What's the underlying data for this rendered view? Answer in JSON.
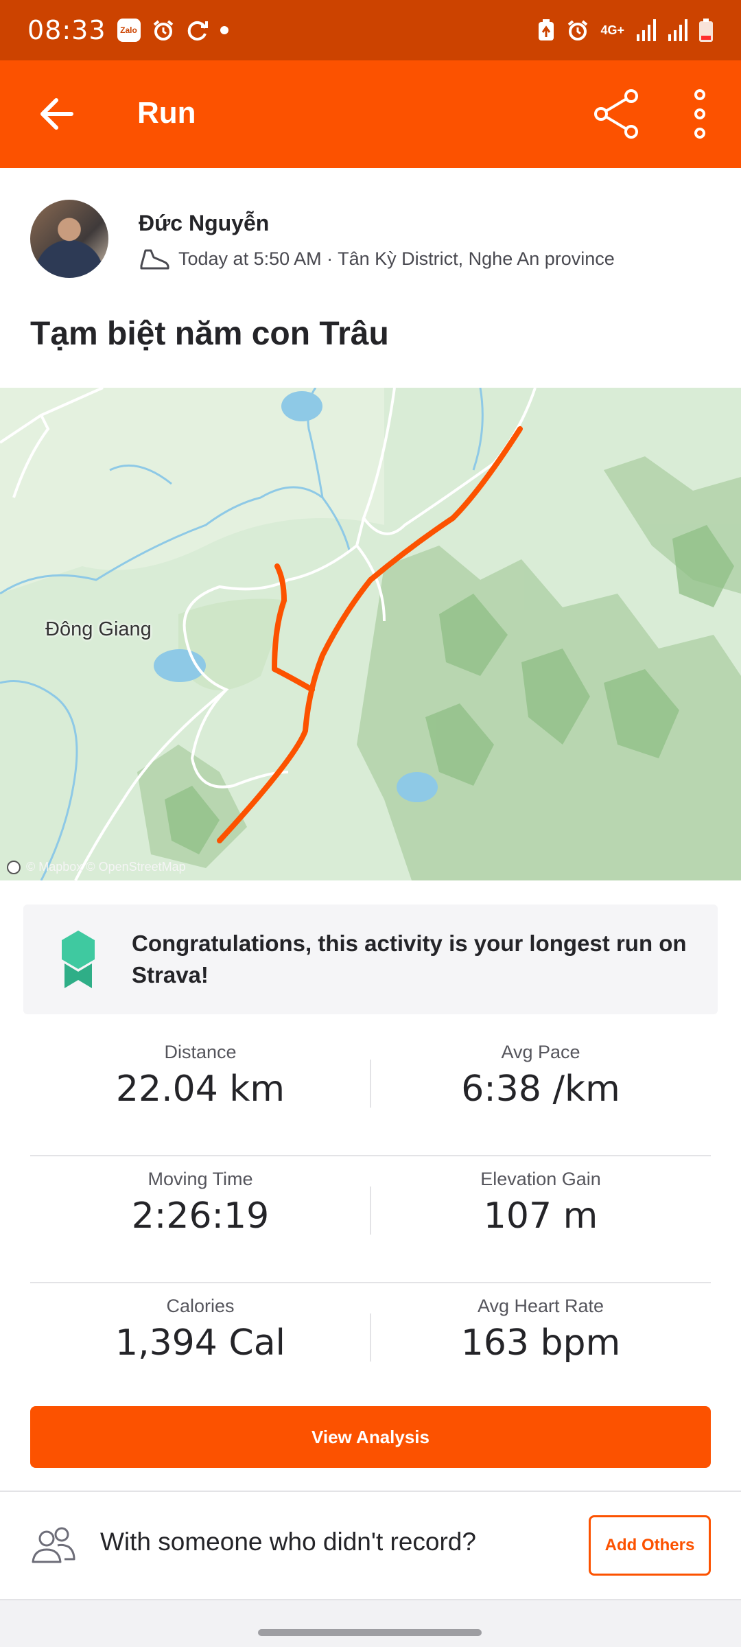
{
  "status_bar": {
    "time": "08:33",
    "left_icons": [
      "zalo-icon",
      "alarm-icon",
      "sync-icon",
      "dot-icon"
    ],
    "zalo_label": "Zalo",
    "network_label": "4G+",
    "right_icons": [
      "battery-saver-icon",
      "alarm-icon",
      "network-4g-icon",
      "signal-icon",
      "signal-icon",
      "battery-icon"
    ]
  },
  "app_bar": {
    "title": "Run",
    "icons": [
      "back-arrow-icon",
      "share-icon",
      "more-vertical-icon"
    ]
  },
  "athlete": {
    "name": "Đức Nguyễn",
    "meta": "Today at 5:50 AM · Tân Kỳ District, Nghe An province",
    "sport_icon": "shoe-icon"
  },
  "activity": {
    "title": "Tạm biệt năm con Trâu"
  },
  "map": {
    "place_label": "Đông Giang",
    "attribution": "© Mapbox © OpenStreetMap",
    "route_color": "#fc5200"
  },
  "achievement": {
    "text": "Congratulations, this activity is your longest run on Strava!",
    "icon": "achievement-badge-icon",
    "badge_color": "#3fc9a0"
  },
  "stats": [
    {
      "left": {
        "label": "Distance",
        "value": "22.04 km"
      },
      "right": {
        "label": "Avg Pace",
        "value": "6:38 /km"
      }
    },
    {
      "left": {
        "label": "Moving Time",
        "value": "2:26:19"
      },
      "right": {
        "label": "Elevation Gain",
        "value": "107 m"
      }
    },
    {
      "left": {
        "label": "Calories",
        "value": "1,394 Cal"
      },
      "right": {
        "label": "Avg Heart Rate",
        "value": "163 bpm"
      }
    }
  ],
  "actions": {
    "view_analysis": "View Analysis",
    "with_others_text": "With someone who didn't record?",
    "add_others": "Add Others",
    "people_icon": "people-icon"
  },
  "colors": {
    "brand": "#fc5200",
    "status_bar": "#cc4300"
  }
}
